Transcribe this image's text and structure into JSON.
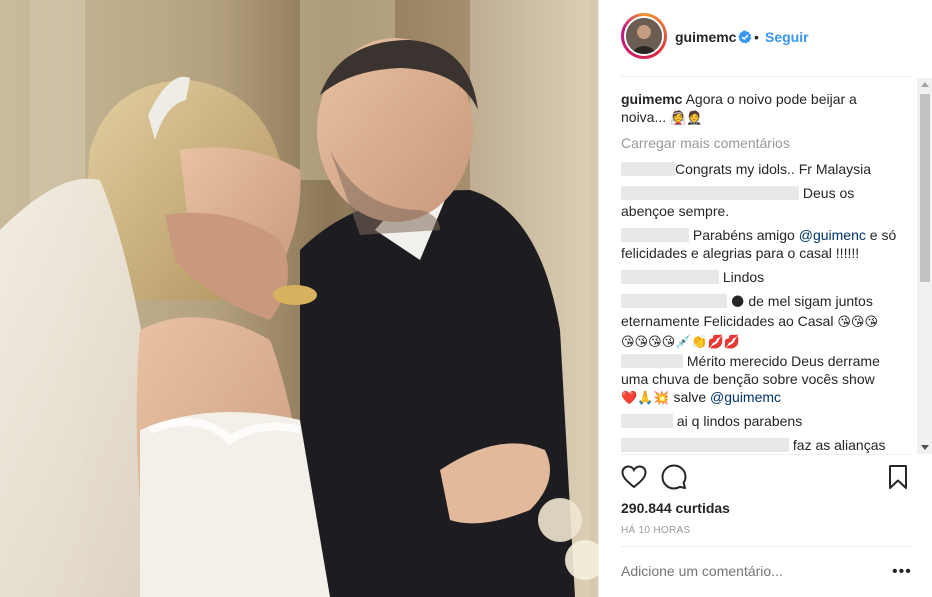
{
  "post": {
    "username": "guimemc",
    "verified": true,
    "follow_label": "Seguir",
    "separator": "•"
  },
  "caption": {
    "username": "guimemc",
    "text_line1": "Agora o noivo pode beijar a",
    "text_line2": "noiva...",
    "emoji": "👰🤵"
  },
  "load_more_label": "Carregar mais comentários",
  "comments": [
    {
      "text": "Congrats my idols.. Fr Malaysia"
    },
    {
      "text_line1": "Deus os",
      "text_line2": "abençoe sempre."
    },
    {
      "text_line1_pre": "Parabéns amigo",
      "mention": "@guimenc",
      "text_line1_post": "e só",
      "text_line2": "felicidades e alegrias para o casal !!!!!!"
    },
    {
      "text": "Lindos"
    },
    {
      "emoji1": "🌑",
      "text_line1": "de mel sigam juntos",
      "text_line2": "eternamente Felicidades ao Casal",
      "emoji2": "😘😘😘",
      "emoji3": "😘😘😘😘💉👏💋💋"
    },
    {
      "text_line1": "Mérito merecido Deus derrame",
      "text_line2": "uma chuva de benção sobre vocês show",
      "emoji": "❤️🙏💥",
      "text_line3": "salve",
      "mention": "@guimemc"
    },
    {
      "text": "ai q lindos parabens"
    },
    {
      "text": "faz as alianças"
    }
  ],
  "likes_label": "290.844 curtidas",
  "time_label": "HÁ 10 HORAS",
  "add_comment_placeholder": "Adicione um comentário...",
  "more_label": "•••",
  "icons": {
    "like": "heart-icon",
    "comment": "comment-bubble-icon",
    "save": "bookmark-icon",
    "verified": "verified-badge-icon"
  },
  "colors": {
    "link_blue": "#3897f0",
    "mention": "#003569",
    "muted": "#999999",
    "verified": "#3897f0"
  }
}
